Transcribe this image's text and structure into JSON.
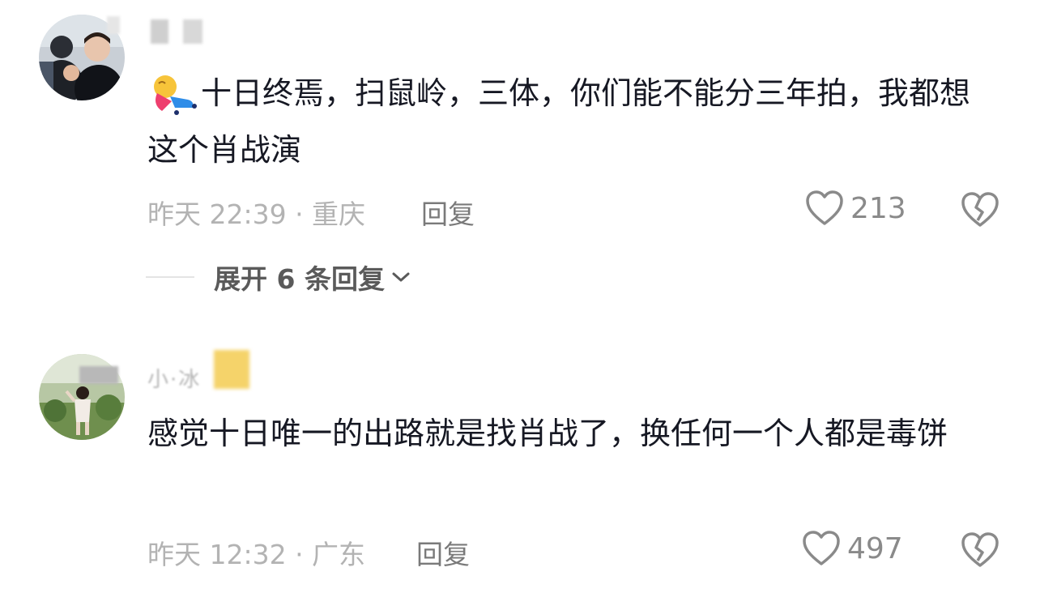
{
  "comments": [
    {
      "text": "十日终焉，扫鼠岭，三体，你们能不能分三年拍，我都想这个肖战演",
      "time_location": "昨天 22:39 · 重庆",
      "reply_label": "回复",
      "like_count": "213",
      "expand_label": "展开 6 条回复"
    },
    {
      "username_partial": "小·冰",
      "text": "感觉十日唯一的出路就是找肖战了，换任何一个人都是毒饼",
      "time_location": "昨天 12:32 · 广东",
      "reply_label": "回复",
      "like_count": "497"
    }
  ],
  "icons": {
    "like": "heart-outline-icon",
    "dislike": "broken-heart-icon",
    "expand": "chevron-down-icon",
    "inline_emoji": "sleeping-figure-emoji"
  },
  "colors": {
    "text": "#161823",
    "meta": "#b3b3b3",
    "icon": "#8a8a8a"
  }
}
